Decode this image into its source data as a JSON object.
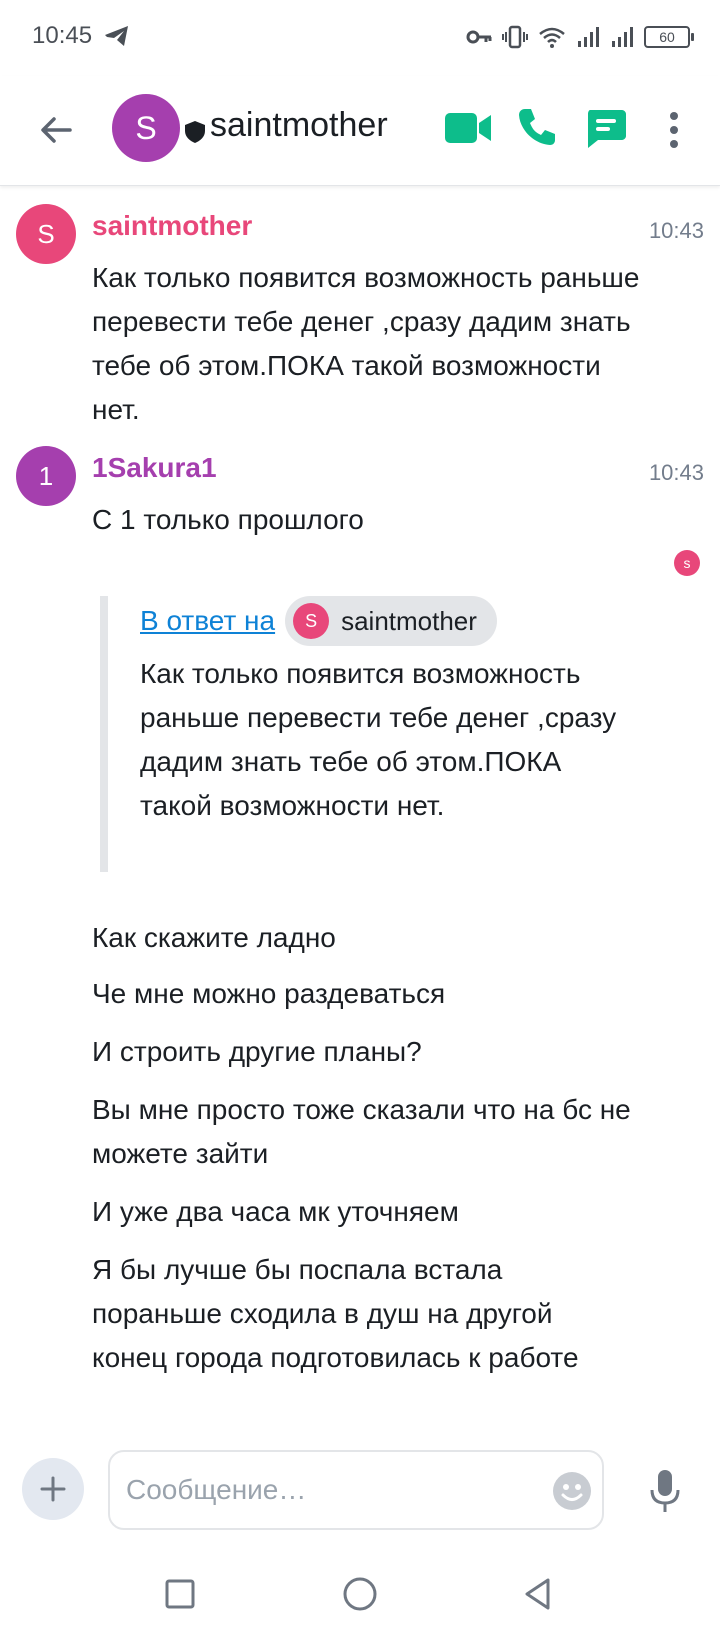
{
  "status_bar": {
    "time": "10:45",
    "battery": "60"
  },
  "header": {
    "avatar_letter": "S",
    "title": "saintmother"
  },
  "messages": [
    {
      "avatar_letter": "S",
      "avatar_color": "#e8477a",
      "sender": "saintmother",
      "sender_color": "#e8477a",
      "time": "10:43",
      "text": "Как только появится возможность раньше  перевести тебе денег ,сразу дадим знать тебе об этом.ПОКА такой возможности нет."
    },
    {
      "avatar_letter": "1",
      "avatar_color": "#a53fae",
      "sender": "1Sakura1",
      "sender_color": "#a53fae",
      "time": "10:43",
      "text": "С 1 только прошлого"
    }
  ],
  "read_receipt": "s",
  "quote": {
    "link_text": "В ответ на",
    "pill_avatar_letter": "S",
    "pill_name": "saintmother",
    "text": "Как только появится возможность раньше перевести тебе денег ,сразу дадим знать тебе об этом.ПОКА такой возможности нет."
  },
  "follow_lines": [
    "Как скажите ладно",
    "Че мне можно раздеваться",
    "И строить другие планы?",
    "Вы мне просто тоже сказали что на бс не можете зайти",
    "И уже два часа мк уточняем",
    "Я бы лучше бы поспала встала пораньше сходила в душ на другой конец города подготовилась к работе"
  ],
  "composer": {
    "placeholder": "Сообщение…"
  },
  "colors": {
    "accent_green": "#0dbd8b",
    "link_blue": "#0e82d6"
  },
  "icons": [
    "back-arrow-icon",
    "shield-icon",
    "video-call-icon",
    "phone-icon",
    "threads-icon",
    "more-vertical-icon",
    "plus-icon",
    "emoji-icon",
    "microphone-icon",
    "telegram-icon",
    "key-icon",
    "vibrate-icon",
    "wifi-icon",
    "signal-icon",
    "battery-icon"
  ]
}
